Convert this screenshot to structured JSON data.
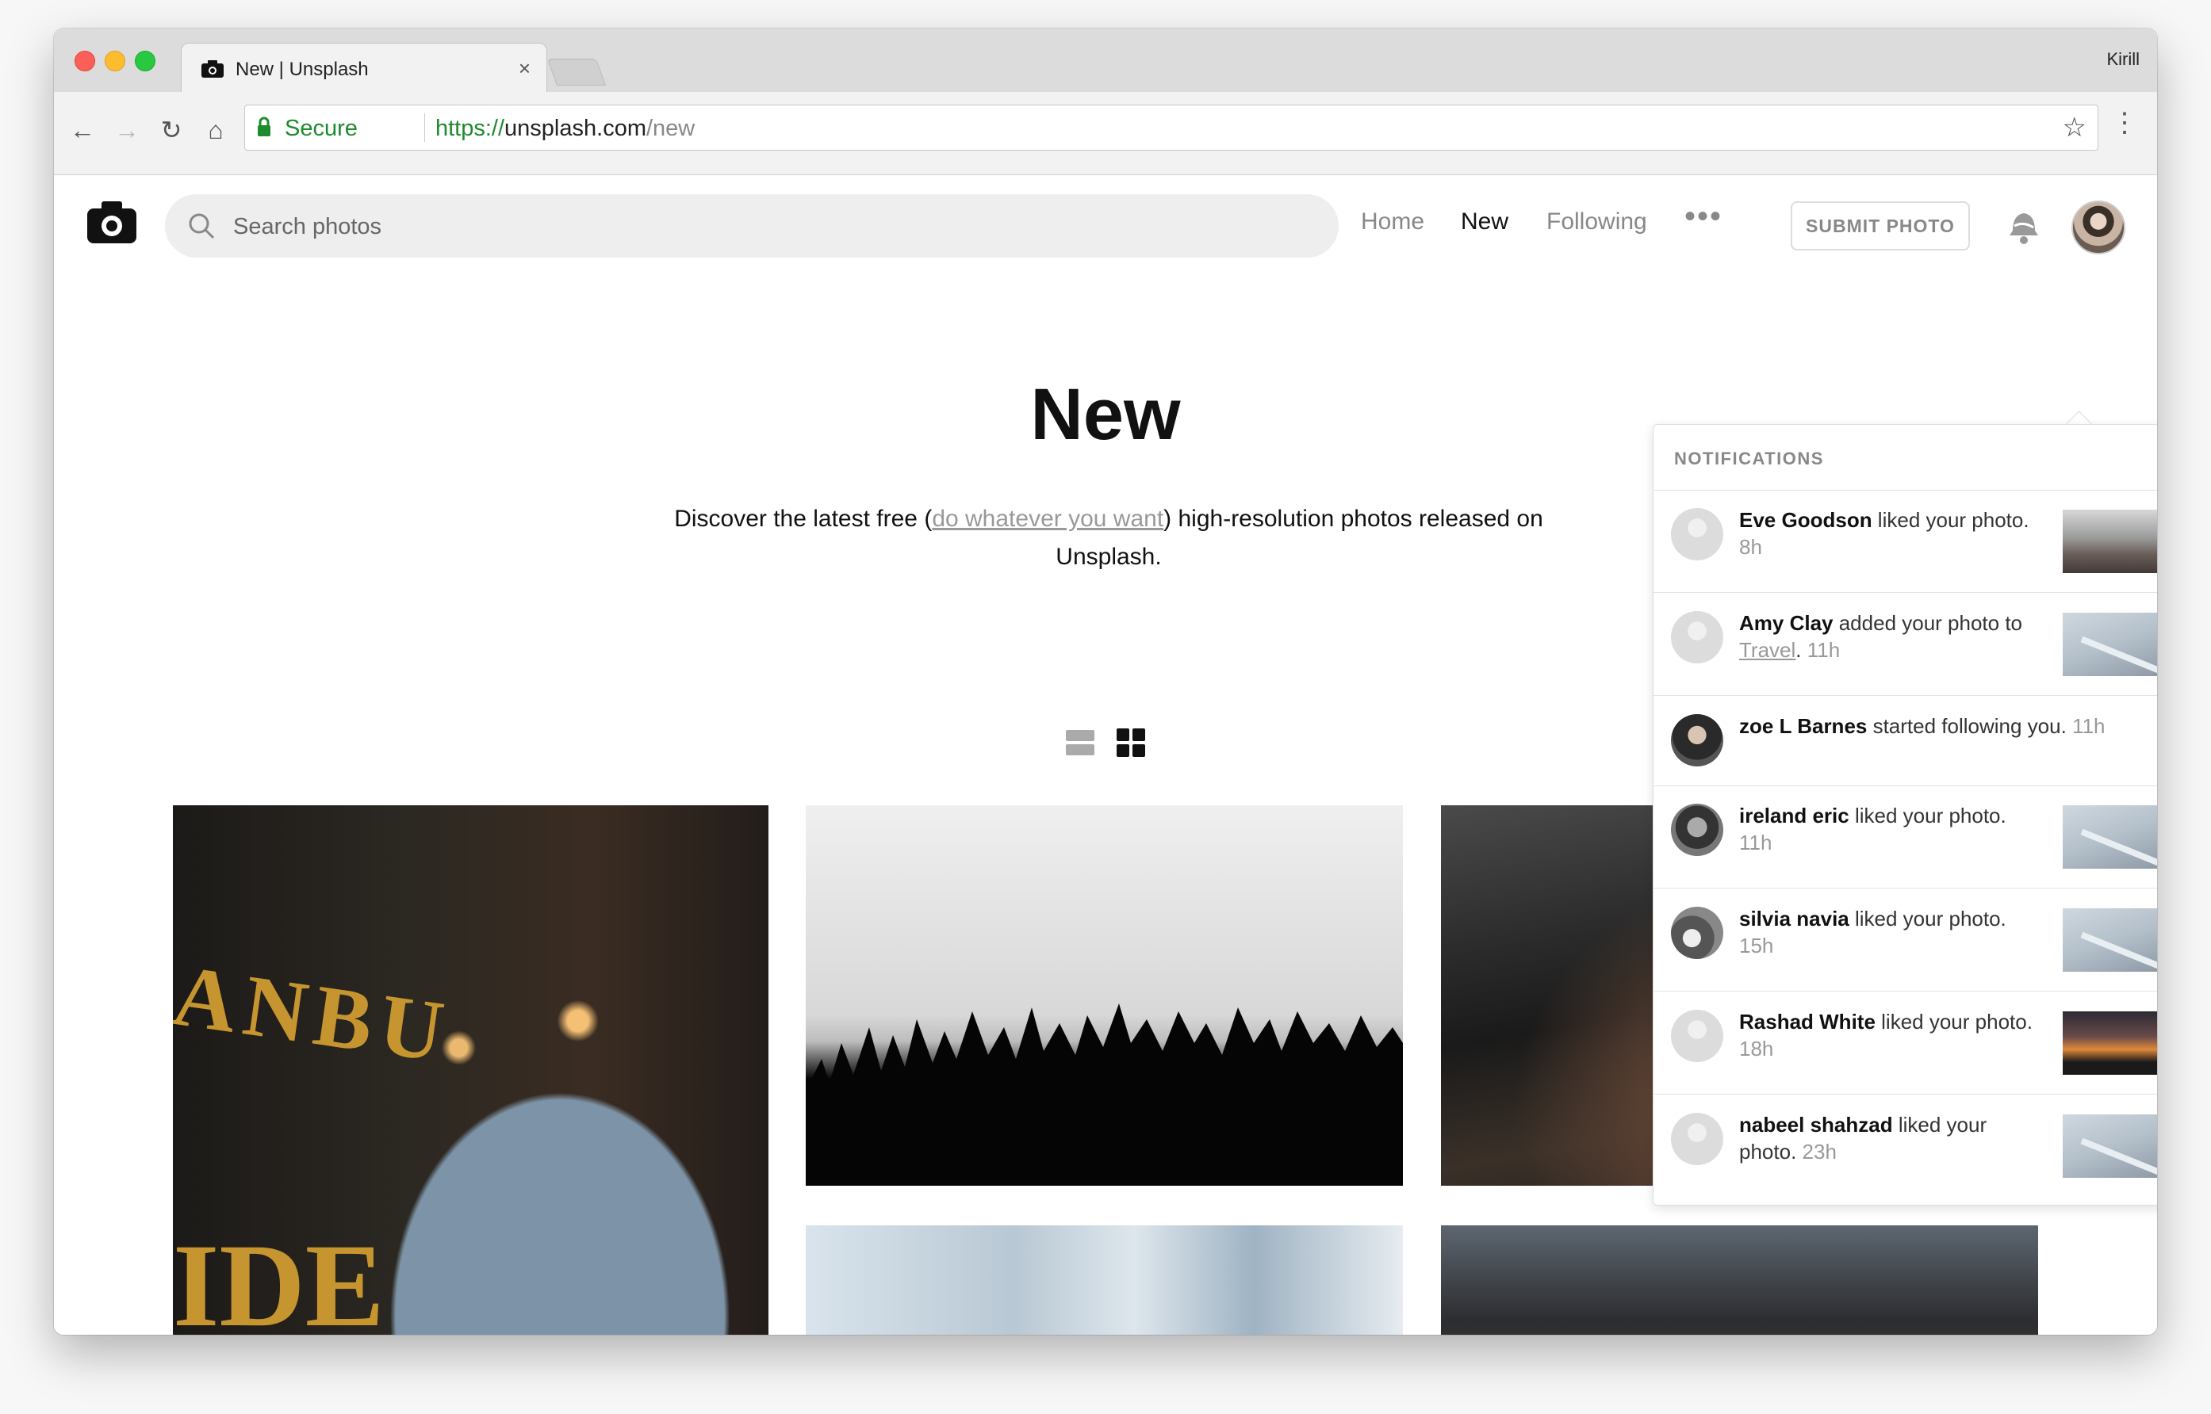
{
  "browser": {
    "tab_title": "New | Unsplash",
    "tab_close": "×",
    "profile_name": "Kirill",
    "secure_label": "Secure",
    "url_scheme": "https://",
    "url_host": "unsplash.com",
    "url_path": "/new"
  },
  "header": {
    "search_placeholder": "Search photos",
    "nav": {
      "home": "Home",
      "new": "New",
      "following": "Following",
      "more": "•••"
    },
    "submit_label": "SUBMIT PHOTO"
  },
  "hero": {
    "title": "New",
    "subtitle_before": "Discover the latest free (",
    "subtitle_link": "do whatever you want",
    "subtitle_after": ") high-resolution photos released on Unsplash."
  },
  "notifications": {
    "title": "NOTIFICATIONS",
    "items": [
      {
        "name": "Eve Goodson",
        "action": " liked your photo.",
        "collection": "",
        "time": "8h"
      },
      {
        "name": "Amy Clay",
        "action": " added your photo to ",
        "collection": "Travel",
        "time": "11h"
      },
      {
        "name": "zoe L Barnes",
        "action": " started following you.",
        "collection": "",
        "time": "11h"
      },
      {
        "name": "ireland eric",
        "action": " liked your photo.",
        "collection": "",
        "time": "11h"
      },
      {
        "name": "silvia navia",
        "action": " liked your photo.",
        "collection": "",
        "time": "15h"
      },
      {
        "name": "Rashad White",
        "action": " liked your photo.",
        "collection": "",
        "time": "18h"
      },
      {
        "name": "nabeel shahzad",
        "action": " liked your photo.",
        "collection": "",
        "time": "23h"
      }
    ]
  },
  "photos": {
    "p1_letters_top": "ANBU",
    "p1_letters_bottom": "IDE"
  },
  "colors": {
    "secure_green": "#1e8a2e",
    "text_primary": "#111111",
    "text_muted": "#888888"
  }
}
